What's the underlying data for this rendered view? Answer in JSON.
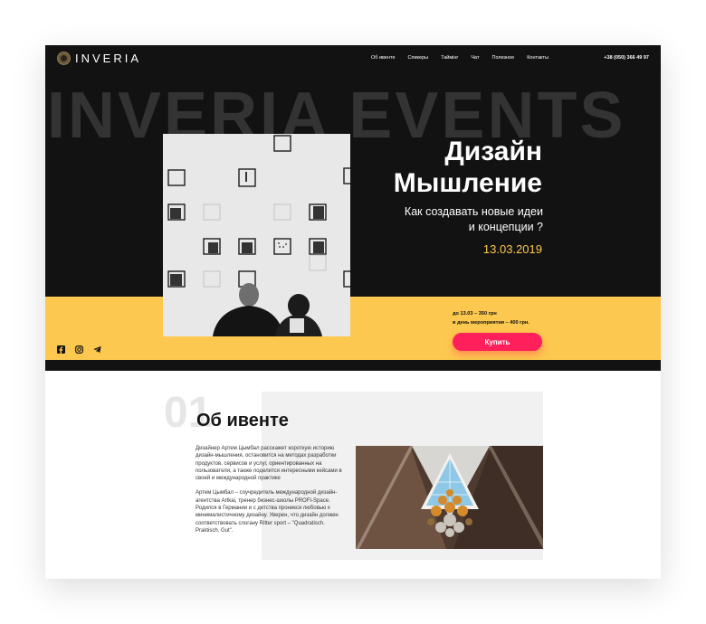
{
  "brand": {
    "name": "INVERIA"
  },
  "nav": {
    "items": [
      "Об ивенте",
      "Спикеры",
      "Таймінг",
      "Чат",
      "Полезное",
      "Контакты"
    ],
    "phone": "+38 (050) 366 49 97"
  },
  "hero": {
    "background_word": "INVERIA EVENTS",
    "title_line1": "Дизайн",
    "title_line2": "Мышление",
    "subtitle_line1": "Как создавать новые идеи",
    "subtitle_line2": "и концепции ?",
    "date": "13.03.2019",
    "price_line1": "до 13.03 – 350 грн",
    "price_line2": "в день мероприятия – 400 грн.",
    "buy_label": "Купить",
    "social_icons": [
      "facebook-icon",
      "instagram-icon",
      "telegram-icon"
    ]
  },
  "about": {
    "number": "01",
    "title": "Об ивенте",
    "paragraph1": "Дизайнер Артем Цымбал расскажет короткую историю дизайн-мышления, остановится на методах разработки продуктов, сервисов и услуг, ориентированных на пользователя, а также поделится интересными кейсами в своей и международной практике",
    "paragraph2": "Артем Цымбал – соучредитель международной дизайн-агентства Artkai, тренер бизнес-школы PROFI-Space. Родился в Германии и с детства проникся любовью к минималистичному дизайну. Уверен, что дизайн должен соответствовать слогану Ritter sport – \"Quadratisch. Praktisch. Gut\"."
  },
  "colors": {
    "dark": "#121212",
    "accent_yellow": "#fdc84f",
    "button_pink": "#ff1f5a"
  }
}
